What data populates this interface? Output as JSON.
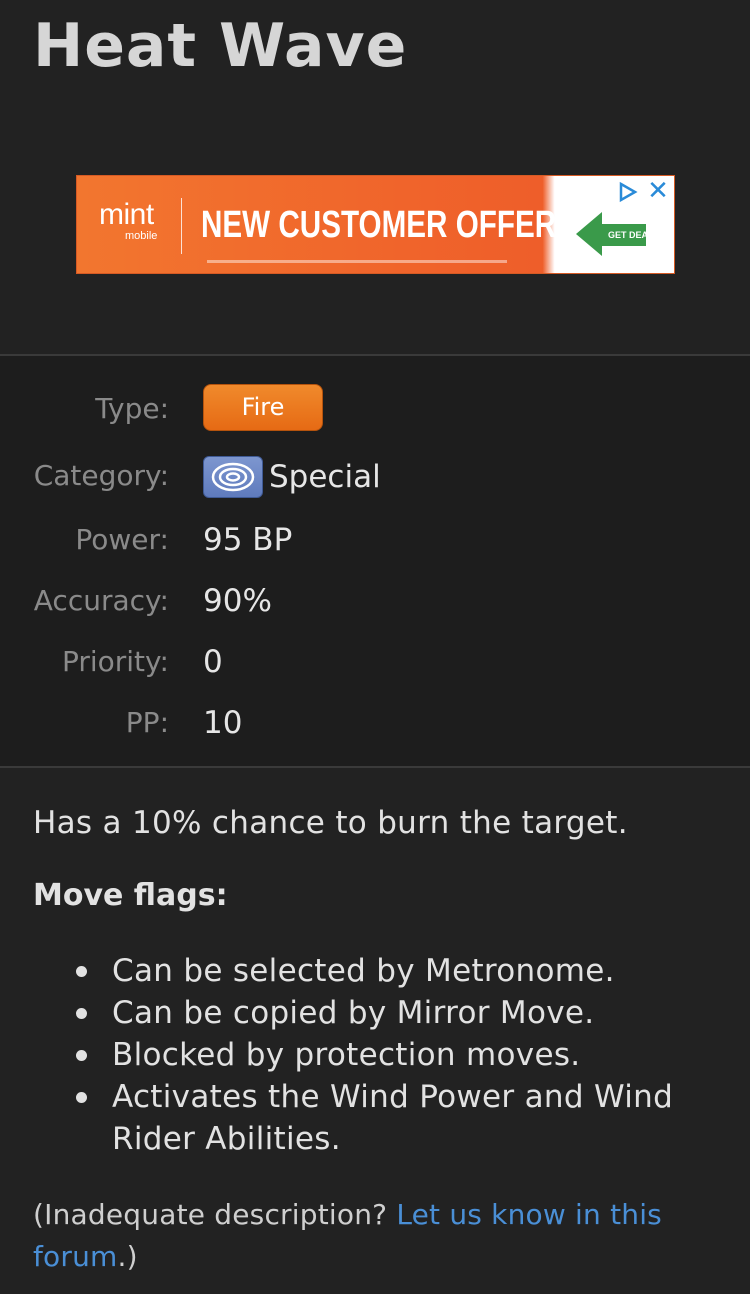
{
  "move": {
    "title": "Heat Wave"
  },
  "ad": {
    "brand": "mint",
    "brand_sub": "mobile",
    "headline": "NEW CUSTOMER OFFER",
    "cta": "GET DEAL",
    "close_icon": "close-icon",
    "adchoices_icon": "adchoices-icon",
    "colors": {
      "background": "#f0642b",
      "accent": "#2a8bd8"
    }
  },
  "stats": {
    "type_label": "Type:",
    "type_value": "Fire",
    "type_color": "#e8721c",
    "category_label": "Category:",
    "category_value": "Special",
    "category_icon": "special-category-icon",
    "power_label": "Power:",
    "power_value": "95 BP",
    "accuracy_label": "Accuracy:",
    "accuracy_value": "90%",
    "priority_label": "Priority:",
    "priority_value": "0",
    "pp_label": "PP:",
    "pp_value": "10"
  },
  "description": "Has a 10% chance to burn the target.",
  "flags": {
    "heading": "Move flags:",
    "items": [
      "Can be selected by Metronome.",
      "Can be copied by Mirror Move.",
      "Blocked by protection moves.",
      "Activates the Wind Power and Wind Rider Abilities."
    ]
  },
  "feedback": {
    "prefix": "(Inadequate description? ",
    "link_text": "Let us know in this forum",
    "suffix": ".)",
    "link_color": "#4a8fd6"
  }
}
